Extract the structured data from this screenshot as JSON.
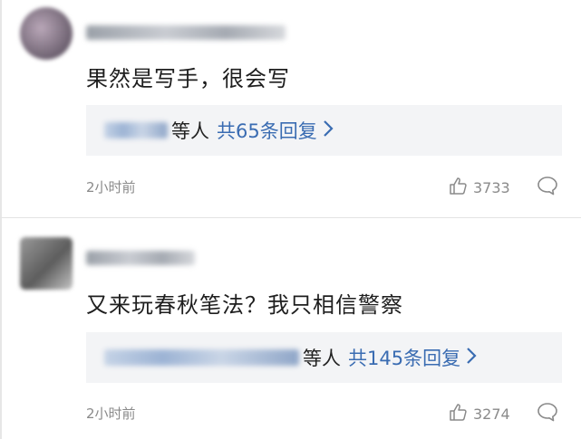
{
  "comments": [
    {
      "text": "果然是写手，很会写",
      "reply_suffix": "等人",
      "reply_link": "共65条回复",
      "time": "2小时前",
      "likes": "3733"
    },
    {
      "text": "又来玩春秋笔法？我只相信警察",
      "reply_suffix": "等人",
      "reply_link": "共145条回复",
      "time": "2小时前",
      "likes": "3274"
    }
  ],
  "colors": {
    "link": "#3a6cb2",
    "muted": "#8a8a8a",
    "reply_bg": "#f3f4f6"
  },
  "icons": [
    "thumbs-up-icon",
    "comment-bubble-icon",
    "chevron-right-icon"
  ]
}
